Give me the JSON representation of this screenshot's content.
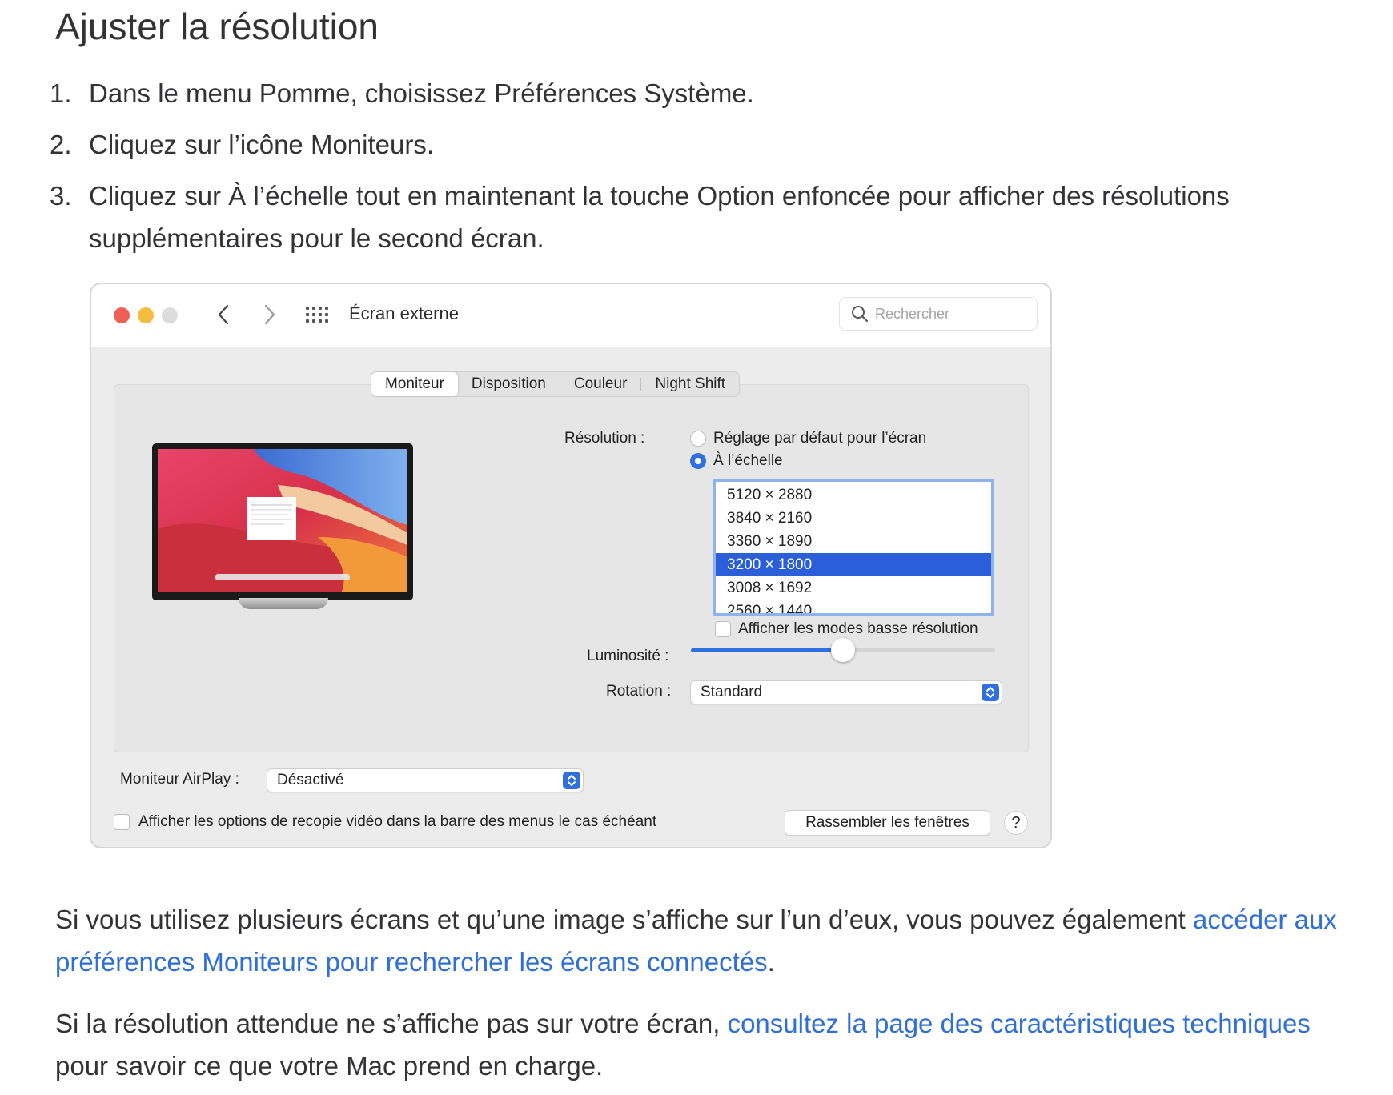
{
  "heading": "Ajuster la résolution",
  "steps": [
    {
      "num": "1.",
      "text": "Dans le menu Pomme, choisissez Préférences Système."
    },
    {
      "num": "2.",
      "text": "Cliquez sur l’icône Moniteurs."
    },
    {
      "num": "3.",
      "text": "Cliquez sur À l’échelle tout en maintenant la touche Option enfoncée pour afficher des résolutions supplémentaires pour le second écran."
    }
  ],
  "window": {
    "title": "Écran externe",
    "search_placeholder": "Rechercher",
    "traffic_colors": [
      "#ee5f57",
      "#f4bd3f",
      "#dcdcdc"
    ],
    "tabs": [
      {
        "label": "Moniteur",
        "active": true
      },
      {
        "label": "Disposition",
        "active": false
      },
      {
        "label": "Couleur",
        "active": false
      },
      {
        "label": "Night Shift",
        "active": false
      }
    ],
    "resolution_label": "Résolution :",
    "radio_default": "Réglage par défaut pour l’écran",
    "radio_scaled": "À l’échelle",
    "resolutions": [
      "5120 × 2880",
      "3840 × 2160",
      "3360 × 1890",
      "3200 × 1800",
      "3008 × 1692",
      "2560 × 1440"
    ],
    "selected_resolution": "3200 × 1800",
    "low_res_checkbox": "Afficher les modes basse résolution",
    "brightness_label": "Luminosité :",
    "brightness_level": 0.5,
    "rotation_label": "Rotation :",
    "rotation_value": "Standard",
    "airplay_label": "Moniteur AirPlay :",
    "airplay_value": "Désactivé",
    "mirror_checkbox": "Afficher les options de recopie vidéo dans la barre des menus le cas échéant",
    "gather_button": "Rassembler les fenêtres",
    "help_button": "?",
    "accent_color": "#2f6fe0"
  },
  "para1": {
    "text": "Si vous utilisez plusieurs écrans et qu’une image s’affiche sur l’un d’eux, vous pouvez également ",
    "link": "accéder aux préférences Moniteurs pour rechercher les écrans connectés",
    "end": "."
  },
  "para2": {
    "text": "Si la résolution attendue ne s’affiche pas sur votre écran, ",
    "link": "consultez la page des caractéristiques techniques",
    "end": " pour savoir ce que votre Mac prend en charge."
  }
}
